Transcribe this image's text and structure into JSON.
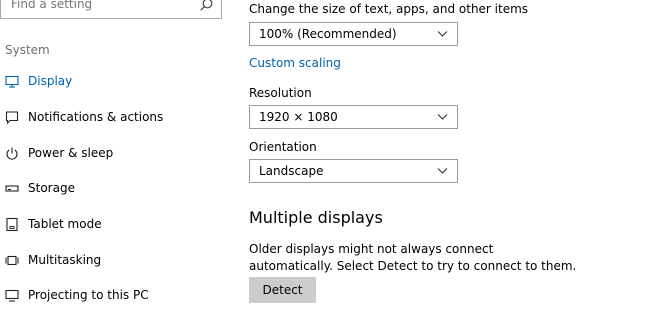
{
  "search": {
    "placeholder": "Find a setting",
    "icon": "search-icon"
  },
  "sidebar": {
    "section": "System",
    "items": [
      {
        "label": "Display",
        "icon": "monitor-icon",
        "active": true
      },
      {
        "label": "Notifications & actions",
        "icon": "notification-icon",
        "active": false
      },
      {
        "label": "Power & sleep",
        "icon": "power-icon",
        "active": false
      },
      {
        "label": "Storage",
        "icon": "storage-icon",
        "active": false
      },
      {
        "label": "Tablet mode",
        "icon": "tablet-icon",
        "active": false
      },
      {
        "label": "Multitasking",
        "icon": "multitasking-icon",
        "active": false
      },
      {
        "label": "Projecting to this PC",
        "icon": "projecting-icon",
        "active": false
      }
    ]
  },
  "main": {
    "scale_label": "Change the size of text, apps, and other items",
    "scale_value": "100% (Recommended)",
    "custom_scaling": "Custom scaling",
    "resolution_label": "Resolution",
    "resolution_value": "1920 × 1080",
    "orientation_label": "Orientation",
    "orientation_value": "Landscape",
    "multiple_heading": "Multiple displays",
    "multiple_desc": "Older displays might not always connect automatically. Select Detect to try to connect to them.",
    "detect_label": "Detect"
  },
  "colors": {
    "accent": "#0063b1",
    "button_bg": "#cccccc",
    "muted_text": "#707070"
  }
}
